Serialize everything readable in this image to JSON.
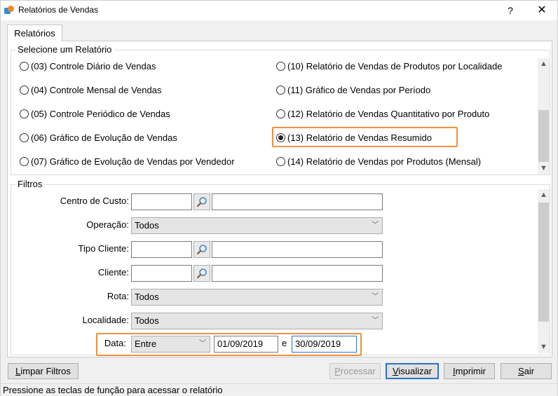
{
  "window": {
    "title": "Relatórios de Vendas",
    "help": "?",
    "close": "✕"
  },
  "tabs": [
    {
      "label": "Relatórios"
    }
  ],
  "reports": {
    "group_label": "Selecione um Relatório",
    "items": [
      {
        "label": "(03) Controle Diário de Vendas",
        "checked": false
      },
      {
        "label": "(04) Controle Mensal de Vendas",
        "checked": false
      },
      {
        "label": "(05) Controle Periódico de Vendas",
        "checked": false
      },
      {
        "label": "(06) Gráfico de Evolução de Vendas",
        "checked": false
      },
      {
        "label": "(07) Gráfico de Evolução de Vendas por Vendedor",
        "checked": false
      },
      {
        "label": "(10) Relatório de Vendas de Produtos por Localidade",
        "checked": false
      },
      {
        "label": "(11) Gráfico de Vendas por Período",
        "checked": false
      },
      {
        "label": "(12) Relatório de Vendas Quantitativo por Produto",
        "checked": false
      },
      {
        "label": "(13) Relatório de Vendas Resumido",
        "checked": true
      },
      {
        "label": "(14) Relatório de Vendas por Produtos (Mensal)",
        "checked": false
      }
    ]
  },
  "filters": {
    "group_label": "Filtros",
    "centro_custo": {
      "label": "Centro de Custo:",
      "code": "",
      "desc": ""
    },
    "operacao": {
      "label": "Operação:",
      "value": "Todos"
    },
    "tipo_cliente": {
      "label": "Tipo Cliente:",
      "code": "",
      "desc": ""
    },
    "cliente": {
      "label": "Cliente:",
      "code": "",
      "desc": ""
    },
    "rota": {
      "label": "Rota:",
      "value": "Todos"
    },
    "localidade": {
      "label": "Localidade:",
      "value": "Todos"
    },
    "data": {
      "label": "Data:",
      "mode": "Entre",
      "from": "01/09/2019",
      "sep": "e",
      "to": "30/09/2019"
    }
  },
  "buttons": {
    "limpar": {
      "mn": "L",
      "rest": "impar Filtros"
    },
    "processar": {
      "mn": "P",
      "rest": "rocessar"
    },
    "visualizar": {
      "mn": "V",
      "rest": "isualizar"
    },
    "imprimir": {
      "mn": "I",
      "rest": "mprimir"
    },
    "sair": {
      "mn": "S",
      "rest": "air"
    }
  },
  "status": {
    "text": "Pressione as teclas de função para acessar o relatório"
  },
  "colors": {
    "highlight": "#f0913c",
    "focus": "#2f6fcf"
  }
}
